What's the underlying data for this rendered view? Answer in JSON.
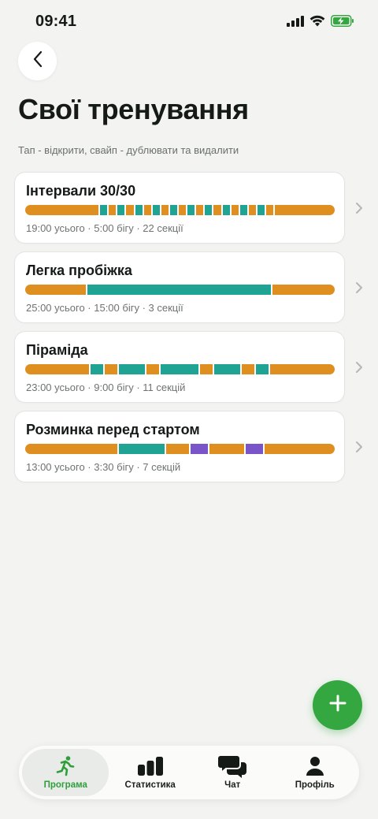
{
  "status": {
    "time": "09:41"
  },
  "header": {
    "title": "Свої тренування",
    "hint": "Тап - відкрити, свайп - дублювати та видалити"
  },
  "colors": {
    "run": "#de8f1f",
    "walk": "#1fa393",
    "extra": "#7a55c8",
    "accent": "#35a741"
  },
  "workouts": [
    {
      "title": "Інтервали 30/30",
      "meta": "19:00 усього · 5:00 бігу · 22 секції",
      "segments": [
        {
          "type": "run",
          "w": 92
        },
        {
          "type": "walk",
          "w": 9
        },
        {
          "type": "run",
          "w": 9
        },
        {
          "type": "walk",
          "w": 9
        },
        {
          "type": "run",
          "w": 9
        },
        {
          "type": "walk",
          "w": 9
        },
        {
          "type": "run",
          "w": 9
        },
        {
          "type": "walk",
          "w": 9
        },
        {
          "type": "run",
          "w": 9
        },
        {
          "type": "walk",
          "w": 9
        },
        {
          "type": "run",
          "w": 9
        },
        {
          "type": "walk",
          "w": 9
        },
        {
          "type": "run",
          "w": 9
        },
        {
          "type": "walk",
          "w": 9
        },
        {
          "type": "run",
          "w": 9
        },
        {
          "type": "walk",
          "w": 9
        },
        {
          "type": "run",
          "w": 9
        },
        {
          "type": "walk",
          "w": 9
        },
        {
          "type": "run",
          "w": 9
        },
        {
          "type": "walk",
          "w": 9
        },
        {
          "type": "run",
          "w": 9
        },
        {
          "type": "run",
          "w": 75
        }
      ]
    },
    {
      "title": "Легка пробіжка",
      "meta": "25:00 усього · 15:00 бігу · 3 секції",
      "segments": [
        {
          "type": "run",
          "w": 77
        },
        {
          "type": "walk",
          "w": 233
        },
        {
          "type": "run",
          "w": 79
        }
      ]
    },
    {
      "title": "Піраміда",
      "meta": "23:00 усього · 9:00 бігу · 11 секцій",
      "segments": [
        {
          "type": "run",
          "w": 80
        },
        {
          "type": "walk",
          "w": 16
        },
        {
          "type": "run",
          "w": 16
        },
        {
          "type": "walk",
          "w": 32
        },
        {
          "type": "run",
          "w": 16
        },
        {
          "type": "walk",
          "w": 48
        },
        {
          "type": "run",
          "w": 16
        },
        {
          "type": "walk",
          "w": 32
        },
        {
          "type": "run",
          "w": 16
        },
        {
          "type": "walk",
          "w": 16
        },
        {
          "type": "run",
          "w": 81
        }
      ]
    },
    {
      "title": "Розминка перед стартом",
      "meta": "13:00 усього · 3:30 бігу · 7 секцій",
      "segments": [
        {
          "type": "run",
          "w": 117
        },
        {
          "type": "walk",
          "w": 58
        },
        {
          "type": "run",
          "w": 29
        },
        {
          "type": "extra",
          "w": 22
        },
        {
          "type": "run",
          "w": 44
        },
        {
          "type": "extra",
          "w": 22
        },
        {
          "type": "run",
          "w": 89
        }
      ]
    }
  ],
  "fab": {
    "icon": "plus-icon"
  },
  "tabbar": {
    "tabs": [
      {
        "label": "Програма",
        "icon": "running-person-icon",
        "active": true
      },
      {
        "label": "Статистика",
        "icon": "bar-chart-icon",
        "active": false
      },
      {
        "label": "Чат",
        "icon": "chat-bubbles-icon",
        "active": false
      },
      {
        "label": "Профіль",
        "icon": "person-icon",
        "active": false
      }
    ]
  }
}
